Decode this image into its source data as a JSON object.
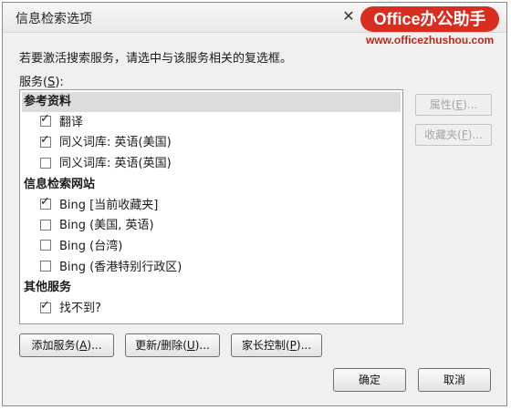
{
  "window": {
    "title": "信息检索选项",
    "close_glyph": "✕"
  },
  "watermark": {
    "badge": "Office办公助手",
    "url": "www.officezhushou.com"
  },
  "instruction": "若要激活搜索服务，请选中与该服务相关的复选框。",
  "services_label": {
    "pre": "服务(",
    "key": "S",
    "post": "):"
  },
  "categories": [
    {
      "name": "参考资料",
      "selected": true,
      "items": [
        {
          "label": "翻译",
          "checked": true
        },
        {
          "label": "同义词库: 英语(美国)",
          "checked": true
        },
        {
          "label": "同义词库: 英语(英国)",
          "checked": false
        }
      ]
    },
    {
      "name": "信息检索网站",
      "selected": false,
      "items": [
        {
          "label": "Bing [当前收藏夹]",
          "checked": true
        },
        {
          "label": "Bing (美国, 英语)",
          "checked": false
        },
        {
          "label": "Bing (台湾)",
          "checked": false
        },
        {
          "label": "Bing (香港特别行政区)",
          "checked": false
        }
      ]
    },
    {
      "name": "其他服务",
      "selected": false,
      "items": [
        {
          "label": "找不到?",
          "checked": true
        }
      ]
    }
  ],
  "side_buttons": {
    "properties": {
      "pre": "属性(",
      "key": "E",
      "post": ")...",
      "enabled": false
    },
    "favorites": {
      "pre": "收藏夹(",
      "key": "F",
      "post": ")...",
      "enabled": false
    }
  },
  "bottom_buttons": {
    "add": {
      "pre": "添加服务(",
      "key": "A",
      "post": ")..."
    },
    "update": {
      "pre": "更新/删除(",
      "key": "U",
      "post": ")..."
    },
    "parental": {
      "pre": "家长控制(",
      "key": "P",
      "post": ")..."
    }
  },
  "dialog_buttons": {
    "ok": "确定",
    "cancel": "取消"
  },
  "colors": {
    "watermark_red": "#d92e1f",
    "disabled_text": "#a6a6a6",
    "selection": "#dcdcdc"
  }
}
